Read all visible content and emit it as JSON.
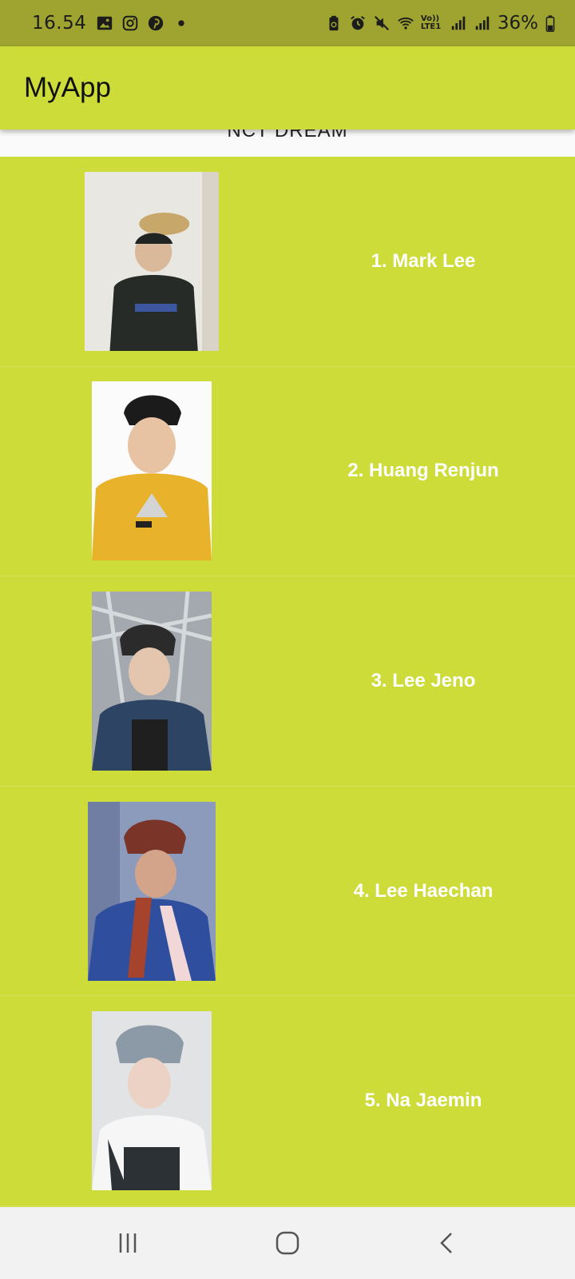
{
  "status_bar": {
    "time": "16.54",
    "left_icons": [
      "gallery-icon",
      "instagram-icon",
      "pinterest-icon",
      "dot-icon"
    ],
    "right_icons": [
      "battery-saver-icon",
      "alarm-icon",
      "mute-icon",
      "wifi-icon",
      "volte-icon",
      "signal-icon",
      "signal-icon-2"
    ],
    "volte_text": "Vo)) LTE1",
    "battery": "36%"
  },
  "app_bar": {
    "title": "MyApp"
  },
  "section": {
    "title": "NCT DREAM"
  },
  "members": [
    {
      "name": "1. Mark Lee",
      "photo_colors": [
        "#eceae6",
        "#2a2e2b",
        "#d7c5a2"
      ]
    },
    {
      "name": "2. Huang Renjun",
      "photo_colors": [
        "#fbfbfb",
        "#e9b52a",
        "#1d1d1d"
      ]
    },
    {
      "name": "3. Lee Jeno",
      "photo_colors": [
        "#9aa1a7",
        "#2a3f63",
        "#262626"
      ]
    },
    {
      "name": "4. Lee Haechan",
      "photo_colors": [
        "#8a99b9",
        "#2f4e9c",
        "#8b3f33"
      ]
    },
    {
      "name": "5. Na Jaemin",
      "photo_colors": [
        "#dfe0e2",
        "#f4f4f4",
        "#30353b"
      ]
    }
  ],
  "nav_bar": {
    "buttons": [
      "recent-apps-icon",
      "home-icon",
      "back-icon"
    ]
  },
  "colors": {
    "accent": "#cddc39",
    "status_bar": "#9ea42f",
    "name_text": "#ffffff",
    "nav_bar": "#f2f2f2"
  }
}
